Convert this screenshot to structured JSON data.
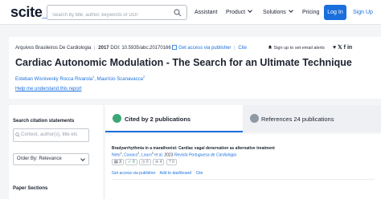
{
  "nav": {
    "logo_main": "scite",
    "logo_suffix": "_",
    "search_placeholder": "Search by title, author, keywords or DOI",
    "assistant": "Assistant",
    "product": "Product",
    "solutions": "Solutions",
    "pricing": "Pricing",
    "login": "Log In",
    "signup": "Sign Up"
  },
  "paper": {
    "journal": "Arquivos Brasileiros De Cardiologia",
    "year": "2017",
    "doi": "DOI: 10.5935/abc.20170166",
    "get_access": "Get access via publisher",
    "cite": "Cite",
    "alert": "Sign up to set email alerts",
    "social": "♥ 𝕏 f in",
    "title": "Cardiac Autonomic Modulation - The Search for an Ultimate Technique",
    "author1": "Esteban Wisnivesky Rocca Rivarola",
    "author1_sup": "1",
    "author_sep": ", ",
    "author2": "Maurício Scanavacca",
    "author2_sup": "2",
    "help": "Help me understand this report"
  },
  "sidebar": {
    "search_heading": "Search citation statements",
    "search_placeholder": "Context, author(s), title etc",
    "order_by": "Order By: Relevance",
    "paper_sections": "Paper Sections"
  },
  "tabs": {
    "cited_by": "Cited by 2 publications",
    "references": "References 24 publications"
  },
  "citation": {
    "title": "Bradyarrhythmia in a marathonist: Cardiac vagal denervation as alternative treatment",
    "author1": "Neto",
    "sup1": "1",
    "sep1": ", ",
    "author2": "Cavaco",
    "sup2": "2",
    "sep2": ", ",
    "author3": "Louro",
    "sup3": "3",
    "etal": " et al.",
    "year": " 2023 ",
    "journal": "Revista Portuguesa de Cardiologia",
    "badge1": "3",
    "badge2": "0",
    "badge3": "0",
    "badge4": "4",
    "badge5": "0",
    "get_access": "Get access via publisher",
    "add_dashboard": "Add to dashboard",
    "cite": "Cite"
  },
  "colors": {
    "accent": "#1a6fdc",
    "supporting": "#3ba776",
    "mentioning": "#8f98a3"
  }
}
